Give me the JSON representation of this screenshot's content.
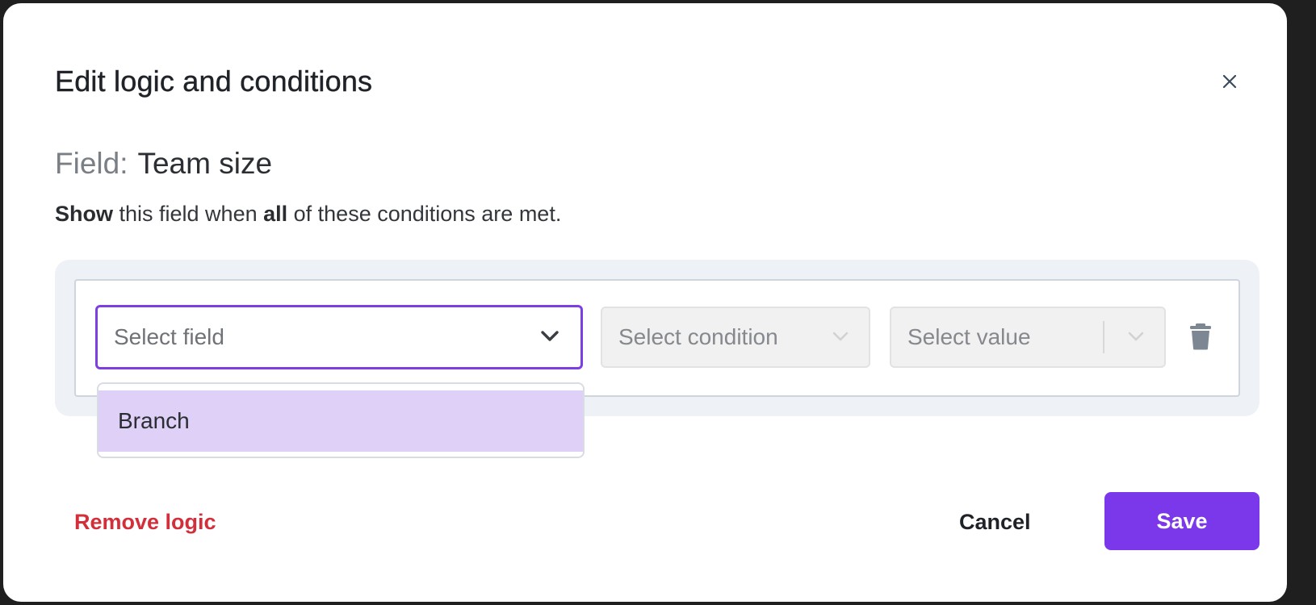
{
  "modal": {
    "title": "Edit logic and conditions",
    "field_prefix": "Field:",
    "field_name": "Team size",
    "description": {
      "part1": "Show",
      "part2": " this field when ",
      "part3": "all",
      "part4": " of these conditions are met."
    }
  },
  "condition_row": {
    "field_placeholder": "Select field",
    "condition_placeholder": "Select condition",
    "value_placeholder": "Select value"
  },
  "dropdown": {
    "options": [
      "Branch"
    ]
  },
  "footer": {
    "remove_label": "Remove logic",
    "cancel_label": "Cancel",
    "save_label": "Save"
  },
  "colors": {
    "accent": "#7a38ea",
    "danger": "#d22f3b",
    "option_highlight": "#dfd0f8"
  },
  "icons": [
    "close-icon",
    "chevron-down-icon",
    "trash-icon"
  ]
}
